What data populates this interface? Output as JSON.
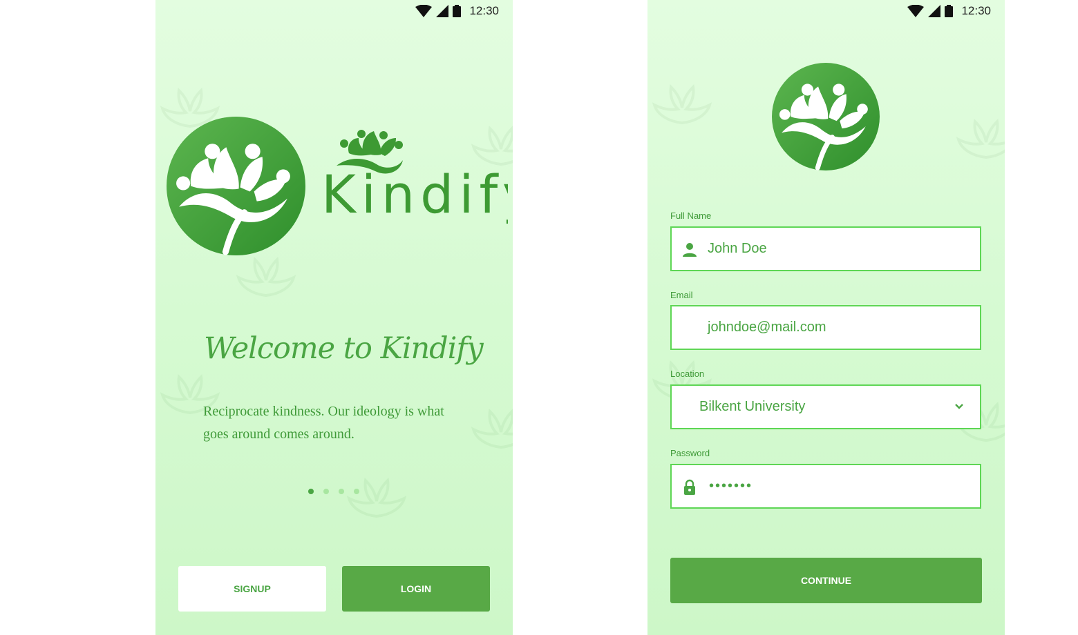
{
  "status_bar": {
    "time": "12:30"
  },
  "welcome_screen": {
    "brand": "Kindify",
    "title": "Welcome to Kindify",
    "subtitle": "Reciprocate kindness. Our ideology is what goes around comes around.",
    "pager": {
      "count": 4,
      "active": 1
    },
    "signup_label": "SIGNUP",
    "login_label": "LOGIN"
  },
  "signup_form": {
    "full_name": {
      "label": "Full Name",
      "value": "John Doe",
      "icon": "person-icon"
    },
    "email": {
      "label": "Email",
      "value": "johndoe@mail.com"
    },
    "location": {
      "label": "Location",
      "value": "Bilkent University",
      "icon": "chevron-down-icon"
    },
    "password": {
      "label": "Password",
      "value": "•••••••",
      "icon": "lock-icon"
    },
    "continue_label": "CONTINUE"
  },
  "colors": {
    "accent": "#58a946",
    "text_green": "#4aa543",
    "field_border": "#5ed655",
    "background": "#d9fbd5"
  }
}
